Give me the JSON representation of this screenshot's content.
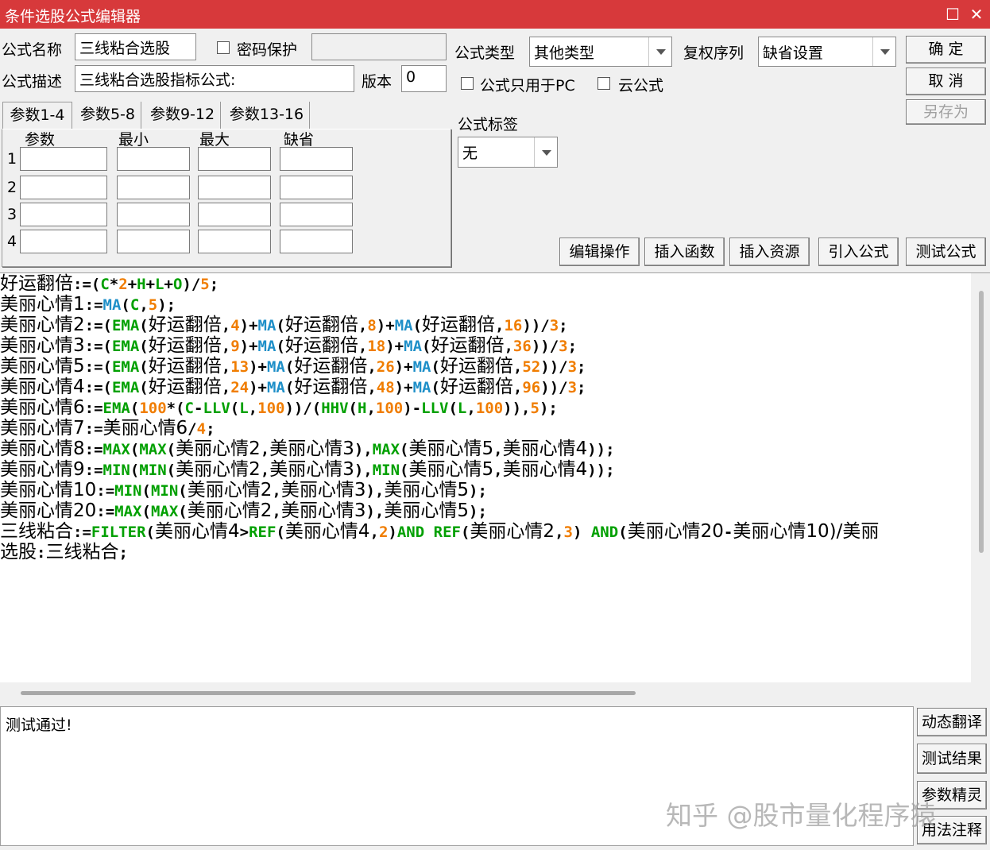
{
  "window": {
    "title": "条件选股公式编辑器",
    "maximize_glyph": "☐",
    "close_glyph": "✕"
  },
  "form": {
    "name_label": "公式名称",
    "name_value": "三线粘合选股",
    "password_label": "密码保护",
    "password_value": "",
    "desc_label": "公式描述",
    "desc_value": "三线粘合选股指标公式:",
    "version_label": "版本",
    "version_value": "0",
    "type_label": "公式类型",
    "type_value": "其他类型",
    "restore_label": "复权序列",
    "restore_value": "缺省设置",
    "pc_only_label": "公式只用于PC",
    "cloud_label": "云公式",
    "tag_label": "公式标签",
    "tag_value": "无"
  },
  "buttons": {
    "ok": "确  定",
    "cancel": "取  消",
    "save_as": "另存为",
    "edit_ops": "编辑操作",
    "insert_func": "插入函数",
    "insert_res": "插入资源",
    "import_formula": "引入公式",
    "test_formula": "测试公式",
    "dyn_translate": "动态翻译",
    "test_result": "测试结果",
    "param_wizard": "参数精灵",
    "usage_notes": "用法注释"
  },
  "tabs": [
    "参数1-4",
    "参数5-8",
    "参数9-12",
    "参数13-16"
  ],
  "params": {
    "headers": [
      "参数",
      "最小",
      "最大",
      "缺省"
    ],
    "rows": [
      "1",
      "2",
      "3",
      "4"
    ]
  },
  "colors": {
    "title_bar": "#d7393b",
    "keyword_green": "#00a000",
    "function_blue": "#1e8fc8",
    "number_orange": "#f07d00",
    "operator_black": "#000000"
  },
  "code_lines": [
    [
      [
        "好运翻倍",
        "t"
      ],
      [
        ":=(",
        "k"
      ],
      [
        "C",
        "g"
      ],
      [
        "*",
        "k"
      ],
      [
        "2",
        "n"
      ],
      [
        "+",
        "k"
      ],
      [
        "H",
        "g"
      ],
      [
        "+",
        "k"
      ],
      [
        "L",
        "g"
      ],
      [
        "+",
        "k"
      ],
      [
        "O",
        "g"
      ],
      [
        ")/",
        "k"
      ],
      [
        "5",
        "n"
      ],
      [
        ";",
        "k"
      ]
    ],
    [
      [
        "美丽心情1",
        "t"
      ],
      [
        ":=",
        "k"
      ],
      [
        "MA",
        "b"
      ],
      [
        "(",
        "k"
      ],
      [
        "C",
        "g"
      ],
      [
        ",",
        "k"
      ],
      [
        "5",
        "n"
      ],
      [
        ");",
        "k"
      ]
    ],
    [
      [
        "美丽心情2",
        "t"
      ],
      [
        ":=(",
        "k"
      ],
      [
        "EMA",
        "g"
      ],
      [
        "(",
        "k"
      ],
      [
        "好运翻倍",
        "t"
      ],
      [
        ",",
        "k"
      ],
      [
        "4",
        "n"
      ],
      [
        ")+",
        "k"
      ],
      [
        "MA",
        "b"
      ],
      [
        "(",
        "k"
      ],
      [
        "好运翻倍",
        "t"
      ],
      [
        ",",
        "k"
      ],
      [
        "8",
        "n"
      ],
      [
        ")+",
        "k"
      ],
      [
        "MA",
        "b"
      ],
      [
        "(",
        "k"
      ],
      [
        "好运翻倍",
        "t"
      ],
      [
        ",",
        "k"
      ],
      [
        "16",
        "n"
      ],
      [
        "))/",
        "k"
      ],
      [
        "3",
        "n"
      ],
      [
        ";",
        "k"
      ]
    ],
    [
      [
        "美丽心情3",
        "t"
      ],
      [
        ":=(",
        "k"
      ],
      [
        "EMA",
        "g"
      ],
      [
        "(",
        "k"
      ],
      [
        "好运翻倍",
        "t"
      ],
      [
        ",",
        "k"
      ],
      [
        "9",
        "n"
      ],
      [
        ")+",
        "k"
      ],
      [
        "MA",
        "b"
      ],
      [
        "(",
        "k"
      ],
      [
        "好运翻倍",
        "t"
      ],
      [
        ",",
        "k"
      ],
      [
        "18",
        "n"
      ],
      [
        ")+",
        "k"
      ],
      [
        "MA",
        "b"
      ],
      [
        "(",
        "k"
      ],
      [
        "好运翻倍",
        "t"
      ],
      [
        ",",
        "k"
      ],
      [
        "36",
        "n"
      ],
      [
        "))/",
        "k"
      ],
      [
        "3",
        "n"
      ],
      [
        ";",
        "k"
      ]
    ],
    [
      [
        "美丽心情5",
        "t"
      ],
      [
        ":=(",
        "k"
      ],
      [
        "EMA",
        "g"
      ],
      [
        "(",
        "k"
      ],
      [
        "好运翻倍",
        "t"
      ],
      [
        ",",
        "k"
      ],
      [
        "13",
        "n"
      ],
      [
        ")+",
        "k"
      ],
      [
        "MA",
        "b"
      ],
      [
        "(",
        "k"
      ],
      [
        "好运翻倍",
        "t"
      ],
      [
        ",",
        "k"
      ],
      [
        "26",
        "n"
      ],
      [
        ")+",
        "k"
      ],
      [
        "MA",
        "b"
      ],
      [
        "(",
        "k"
      ],
      [
        "好运翻倍",
        "t"
      ],
      [
        ",",
        "k"
      ],
      [
        "52",
        "n"
      ],
      [
        "))/",
        "k"
      ],
      [
        "3",
        "n"
      ],
      [
        ";",
        "k"
      ]
    ],
    [
      [
        "美丽心情4",
        "t"
      ],
      [
        ":=(",
        "k"
      ],
      [
        "EMA",
        "g"
      ],
      [
        "(",
        "k"
      ],
      [
        "好运翻倍",
        "t"
      ],
      [
        ",",
        "k"
      ],
      [
        "24",
        "n"
      ],
      [
        ")+",
        "k"
      ],
      [
        "MA",
        "b"
      ],
      [
        "(",
        "k"
      ],
      [
        "好运翻倍",
        "t"
      ],
      [
        ",",
        "k"
      ],
      [
        "48",
        "n"
      ],
      [
        ")+",
        "k"
      ],
      [
        "MA",
        "b"
      ],
      [
        "(",
        "k"
      ],
      [
        "好运翻倍",
        "t"
      ],
      [
        ",",
        "k"
      ],
      [
        "96",
        "n"
      ],
      [
        "))/",
        "k"
      ],
      [
        "3",
        "n"
      ],
      [
        ";",
        "k"
      ]
    ],
    [
      [
        "美丽心情6",
        "t"
      ],
      [
        ":=",
        "k"
      ],
      [
        "EMA",
        "g"
      ],
      [
        "(",
        "k"
      ],
      [
        "100",
        "n"
      ],
      [
        "*(",
        "k"
      ],
      [
        "C",
        "g"
      ],
      [
        "-",
        "k"
      ],
      [
        "LLV",
        "g"
      ],
      [
        "(",
        "k"
      ],
      [
        "L",
        "g"
      ],
      [
        ",",
        "k"
      ],
      [
        "100",
        "n"
      ],
      [
        "))/(",
        "k"
      ],
      [
        "HHV",
        "g"
      ],
      [
        "(",
        "k"
      ],
      [
        "H",
        "g"
      ],
      [
        ",",
        "k"
      ],
      [
        "100",
        "n"
      ],
      [
        ")-",
        "k"
      ],
      [
        "LLV",
        "g"
      ],
      [
        "(",
        "k"
      ],
      [
        "L",
        "g"
      ],
      [
        ",",
        "k"
      ],
      [
        "100",
        "n"
      ],
      [
        "))",
        "k"
      ],
      [
        ",",
        "k"
      ],
      [
        "5",
        "n"
      ],
      [
        ");",
        "k"
      ]
    ],
    [
      [
        "美丽心情7",
        "t"
      ],
      [
        ":=",
        "k"
      ],
      [
        "美丽心情6",
        "t"
      ],
      [
        "/",
        "k"
      ],
      [
        "4",
        "n"
      ],
      [
        ";",
        "k"
      ]
    ],
    [
      [
        "美丽心情8",
        "t"
      ],
      [
        ":=",
        "k"
      ],
      [
        "MAX",
        "g"
      ],
      [
        "(",
        "k"
      ],
      [
        "MAX",
        "g"
      ],
      [
        "(",
        "k"
      ],
      [
        "美丽心情2",
        "t"
      ],
      [
        ",",
        "k"
      ],
      [
        "美丽心情3",
        "t"
      ],
      [
        "),",
        "k"
      ],
      [
        "MAX",
        "g"
      ],
      [
        "(",
        "k"
      ],
      [
        "美丽心情5",
        "t"
      ],
      [
        ",",
        "k"
      ],
      [
        "美丽心情4",
        "t"
      ],
      [
        "));",
        "k"
      ]
    ],
    [
      [
        "美丽心情9",
        "t"
      ],
      [
        ":=",
        "k"
      ],
      [
        "MIN",
        "g"
      ],
      [
        "(",
        "k"
      ],
      [
        "MIN",
        "g"
      ],
      [
        "(",
        "k"
      ],
      [
        "美丽心情2",
        "t"
      ],
      [
        ",",
        "k"
      ],
      [
        "美丽心情3",
        "t"
      ],
      [
        "),",
        "k"
      ],
      [
        "MIN",
        "g"
      ],
      [
        "(",
        "k"
      ],
      [
        "美丽心情5",
        "t"
      ],
      [
        ",",
        "k"
      ],
      [
        "美丽心情4",
        "t"
      ],
      [
        "));",
        "k"
      ]
    ],
    [
      [
        "美丽心情10",
        "t"
      ],
      [
        ":=",
        "k"
      ],
      [
        "MIN",
        "g"
      ],
      [
        "(",
        "k"
      ],
      [
        "MIN",
        "g"
      ],
      [
        "(",
        "k"
      ],
      [
        "美丽心情2",
        "t"
      ],
      [
        ",",
        "k"
      ],
      [
        "美丽心情3",
        "t"
      ],
      [
        "),",
        "k"
      ],
      [
        "美丽心情5",
        "t"
      ],
      [
        ");",
        "k"
      ]
    ],
    [
      [
        "美丽心情20",
        "t"
      ],
      [
        ":=",
        "k"
      ],
      [
        "MAX",
        "g"
      ],
      [
        "(",
        "k"
      ],
      [
        "MAX",
        "g"
      ],
      [
        "(",
        "k"
      ],
      [
        "美丽心情2",
        "t"
      ],
      [
        ",",
        "k"
      ],
      [
        "美丽心情3",
        "t"
      ],
      [
        "),",
        "k"
      ],
      [
        "美丽心情5",
        "t"
      ],
      [
        ");",
        "k"
      ]
    ],
    [
      [
        "三线粘合",
        "t"
      ],
      [
        ":=",
        "k"
      ],
      [
        "FILTER",
        "g"
      ],
      [
        "(",
        "k"
      ],
      [
        "美丽心情4",
        "t"
      ],
      [
        ">",
        "k"
      ],
      [
        "REF",
        "g"
      ],
      [
        "(",
        "k"
      ],
      [
        "美丽心情4",
        "t"
      ],
      [
        ",",
        "k"
      ],
      [
        "2",
        "n"
      ],
      [
        ")",
        "k"
      ],
      [
        "AND",
        "g"
      ],
      [
        " ",
        "k"
      ],
      [
        "REF",
        "g"
      ],
      [
        "(",
        "k"
      ],
      [
        "美丽心情2",
        "t"
      ],
      [
        ",",
        "k"
      ],
      [
        "3",
        "n"
      ],
      [
        ") ",
        "k"
      ],
      [
        "AND",
        "g"
      ],
      [
        "(",
        "k"
      ],
      [
        "美丽心情20",
        "t"
      ],
      [
        "-",
        "k"
      ],
      [
        "美丽心情10",
        "t"
      ],
      [
        ")/美丽",
        "k"
      ]
    ],
    [
      [
        "选股",
        "t"
      ],
      [
        ":",
        "k"
      ],
      [
        "三线粘合",
        "t"
      ],
      [
        ";",
        "k"
      ]
    ]
  ],
  "output": {
    "message": "测试通过!"
  },
  "watermark": "知乎 @股市量化程序猿"
}
